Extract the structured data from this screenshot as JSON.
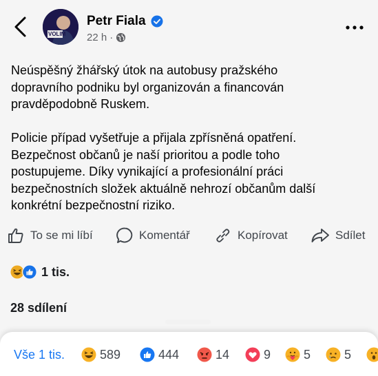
{
  "author": {
    "name": "Petr Fiala",
    "time": "22 h",
    "separator": "·",
    "avatar_badge": "VOLIM"
  },
  "post": {
    "text": "Neúspěšný žhářský útok na autobusy pražského\ndopravního podniku byl organizován a financován\npravděpodobně Ruskem.\n\nPolicie případ vyšetřuje a přijala zpřísněná opatření.\nBezpečnost občanů je naší prioritou a podle toho\npostupujeme. Díky vynikající a profesionální práci\nbezpečnostních složek aktuálně nehrozí občanům další\nkonkrétní bezpečnostní riziko."
  },
  "actions": {
    "like": "To se mi líbí",
    "comment": "Komentář",
    "copy": "Kopírovat",
    "share": "Sdílet"
  },
  "summary": {
    "reactions_count": "1 tis.",
    "shares": "28 sdílení"
  },
  "reaction_tabs": {
    "all": "Vše 1 tis.",
    "haha": "589",
    "like": "444",
    "angry": "14",
    "love": "9",
    "care": "5",
    "sad": "5"
  },
  "colors": {
    "accent": "#1877f2",
    "angry": "#f0584a",
    "love": "#f33e58",
    "haha": "#f7b125"
  }
}
